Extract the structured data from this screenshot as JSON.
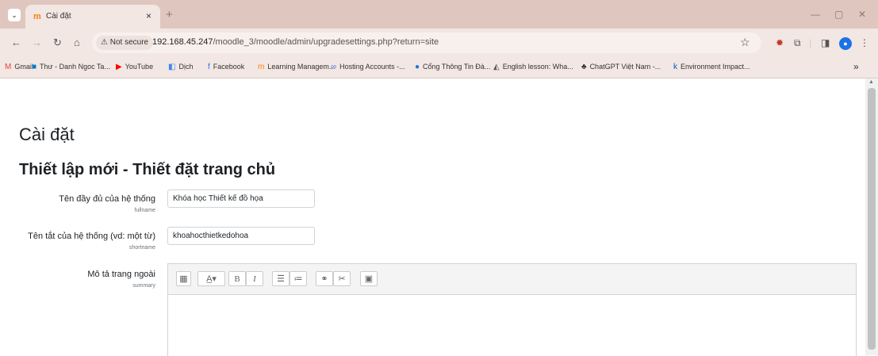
{
  "browser": {
    "tab_title": "Cài đặt",
    "tab_close": "×",
    "new_tab": "+",
    "url_prefix": "192.168.45.247",
    "url_rest": "/moodle_3/moodle/admin/upgradesettings.php?return=site",
    "not_secure": "⚠ Not secure",
    "bookmarks_overflow": "»"
  },
  "bookmarks": [
    {
      "icon": "M",
      "label": "Gmail",
      "color": "#ea4335"
    },
    {
      "icon": "■",
      "label": "Thư - Danh Ngoc Ta...",
      "color": "#0078d4"
    },
    {
      "icon": "▶",
      "label": "YouTube",
      "color": "#ff0000"
    },
    {
      "icon": "◧",
      "label": "Dịch",
      "color": "#4285f4"
    },
    {
      "icon": "f",
      "label": "Facebook",
      "color": "#1877f2"
    },
    {
      "icon": "m",
      "label": "Learning Managem...",
      "color": "#f98012"
    },
    {
      "icon": "∞",
      "label": "Hosting Accounts -...",
      "color": "#4b6ef5"
    },
    {
      "icon": "●",
      "label": "Cổng Thông Tin Đà...",
      "color": "#1a73e8"
    },
    {
      "icon": "◭",
      "label": "English lesson: Wha...",
      "color": "#555555"
    },
    {
      "icon": "♣",
      "label": "ChatGPT Việt Nam -...",
      "color": "#333333"
    },
    {
      "icon": "k",
      "label": "Environment Impact...",
      "color": "#0056d2"
    }
  ],
  "page": {
    "heading": "Cài đặt",
    "section_title": "Thiết lập mới - Thiết đặt trang chủ"
  },
  "form": {
    "fullname": {
      "label": "Tên đầy đủ của hệ thống",
      "key": "fullname",
      "value": "Khóa học Thiết kế đồ họa"
    },
    "shortname": {
      "label": "Tên tắt của hệ thống (vd: một từ)",
      "key": "shortname",
      "value": "khoahocthietkedohoa"
    },
    "summary": {
      "label": "Mô tả trang ngoài",
      "key": "summary"
    }
  }
}
